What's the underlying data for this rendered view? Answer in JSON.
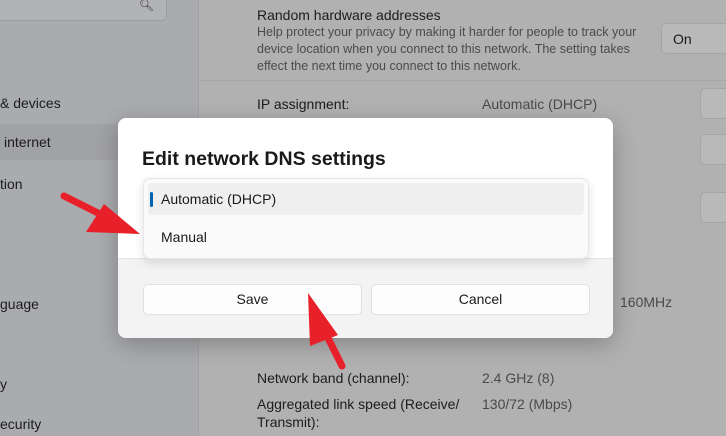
{
  "sidebar": {
    "items": [
      "& devices",
      "internet",
      "tion",
      "guage",
      "y",
      "ecurity"
    ]
  },
  "main": {
    "random_hw_title": "Random hardware addresses",
    "random_hw_desc": "Help protect your privacy by making it harder for people to track your device location when you connect to this network. The setting takes effect the next time you connect to this network.",
    "random_hw_value": "On",
    "ip_label": "IP assignment:",
    "ip_value": "Automatic (DHCP)",
    "bandwidth_partial": "160MHz",
    "band_label": "Network band (channel):",
    "band_value": "2.4 GHz (8)",
    "speed_label": "Aggregated link speed (Receive/ Transmit):",
    "speed_label_1": "Aggregated link speed (Receive/",
    "speed_label_2": "Transmit):",
    "speed_value": "130/72 (Mbps)"
  },
  "dialog": {
    "title": "Edit network DNS settings",
    "options": [
      "Automatic (DHCP)",
      "Manual"
    ],
    "selected": "Automatic (DHCP)",
    "save": "Save",
    "cancel": "Cancel"
  },
  "colors": {
    "accent": "#0063b1",
    "arrow": "#e8202a"
  }
}
